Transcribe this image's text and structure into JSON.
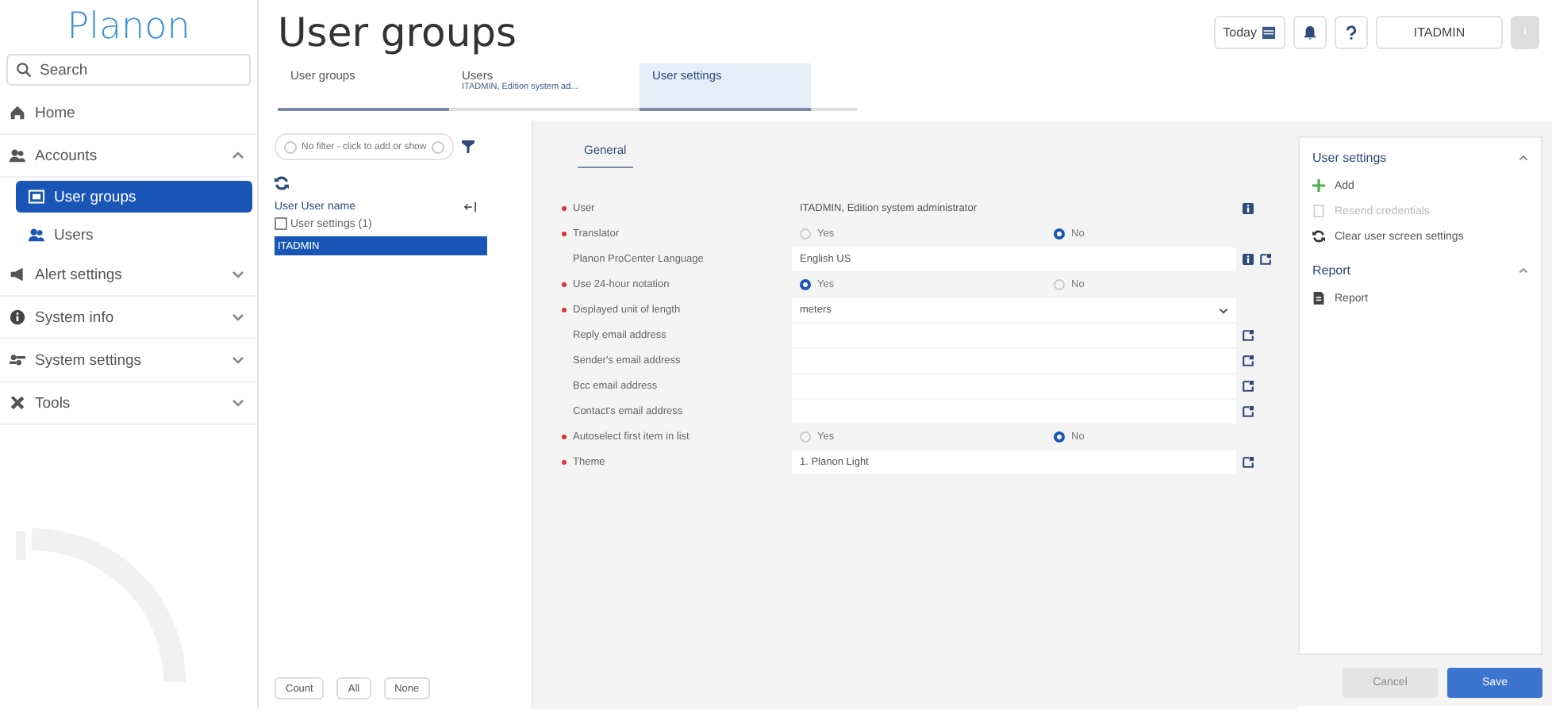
{
  "sidebar": {
    "logo": "Planon",
    "search": {
      "placeholder": "Search"
    },
    "items": [
      {
        "label": "Home"
      },
      {
        "label": "Accounts",
        "expanded": true,
        "children": [
          {
            "label": "User groups",
            "selected": true
          },
          {
            "label": "Users",
            "selected": false
          }
        ]
      },
      {
        "label": "Alert settings",
        "expanded": false
      },
      {
        "label": "System info",
        "expanded": false
      },
      {
        "label": "System settings",
        "expanded": false
      },
      {
        "label": "Tools",
        "expanded": false
      }
    ]
  },
  "header": {
    "title": "User groups",
    "today": "Today",
    "user": "ITADMIN"
  },
  "tabs": [
    {
      "label": "User groups",
      "selected": false
    },
    {
      "label": "Users",
      "subtitle": "ITADMIN, Edition system ad...",
      "selected": false
    },
    {
      "label": "User settings",
      "selected": true
    }
  ],
  "list": {
    "filter": "No filter - click to add or show",
    "column": "User User name",
    "groups": [
      {
        "label": "User settings (1)",
        "checked": false
      }
    ],
    "rows": [
      {
        "label": "ITADMIN",
        "selected": true
      }
    ],
    "buttons": [
      "Count",
      "All",
      "None"
    ]
  },
  "form": {
    "tabs": [
      {
        "label": "General",
        "selected": true
      }
    ],
    "fields": [
      {
        "label": "User",
        "required": true,
        "kind": "display",
        "value": "ITADMIN, Edition system administrator",
        "info": true,
        "lookup": false
      },
      {
        "label": "Translator",
        "required": true,
        "kind": "radio",
        "options": [
          {
            "label": "Yes",
            "selected": false
          },
          {
            "label": "No",
            "selected": true
          }
        ],
        "info": false,
        "lookup": false
      },
      {
        "label": "Planon ProCenter Language",
        "required": false,
        "kind": "text",
        "value": "English US",
        "info": true,
        "lookup": true
      },
      {
        "label": "Use 24-hour notation",
        "required": true,
        "kind": "radio",
        "options": [
          {
            "label": "Yes",
            "selected": true
          },
          {
            "label": "No",
            "selected": false
          }
        ],
        "info": false,
        "lookup": false
      },
      {
        "label": "Displayed unit of length",
        "required": true,
        "kind": "select",
        "value": "meters",
        "info": false,
        "lookup": false
      },
      {
        "label": "Reply email address",
        "required": false,
        "kind": "text",
        "info": false,
        "lookup": true
      },
      {
        "label": "Sender's email address",
        "required": false,
        "kind": "text",
        "info": false,
        "lookup": true
      },
      {
        "label": "Bcc email address",
        "required": false,
        "kind": "text",
        "info": false,
        "lookup": true
      },
      {
        "label": "Contact's email address",
        "required": false,
        "kind": "text",
        "info": false,
        "lookup": true
      },
      {
        "label": "Autoselect first item in list",
        "required": true,
        "kind": "radio",
        "options": [
          {
            "label": "Yes",
            "selected": false
          },
          {
            "label": "No",
            "selected": true
          }
        ],
        "info": false,
        "lookup": false
      },
      {
        "label": "Theme",
        "required": true,
        "kind": "text",
        "value": "1. Planon Light",
        "info": false,
        "lookup": true
      }
    ]
  },
  "actions": {
    "sections": [
      {
        "title": "User settings",
        "expanded": true,
        "items": [
          {
            "label": "Add",
            "disabled": false
          },
          {
            "label": "Resend credentials",
            "disabled": true
          },
          {
            "label": "Clear user screen settings",
            "disabled": false
          }
        ]
      },
      {
        "title": "Report",
        "expanded": true,
        "items": [
          {
            "label": "Report",
            "disabled": false
          }
        ]
      }
    ],
    "buttons": [
      {
        "label": "Cancel",
        "kind": "secondary",
        "disabled": true
      },
      {
        "label": "Save",
        "kind": "primary",
        "disabled": false
      }
    ]
  }
}
